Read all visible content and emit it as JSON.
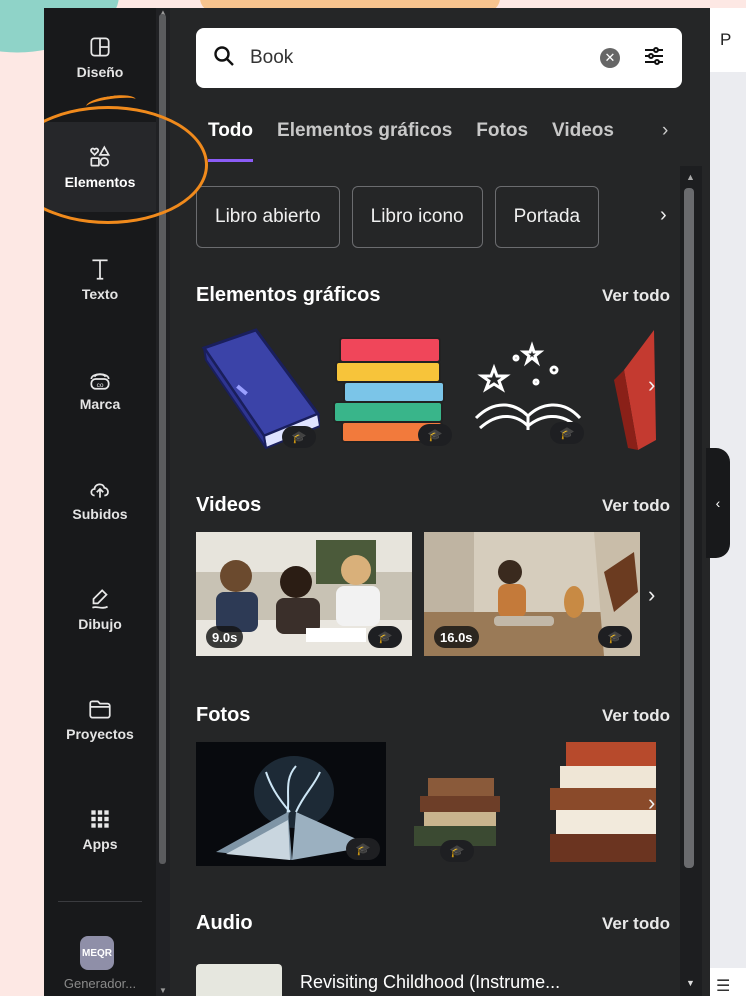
{
  "sidebar": {
    "items": [
      {
        "label": "Diseño",
        "icon": "layout-icon"
      },
      {
        "label": "Elementos",
        "icon": "shapes-icon",
        "active": true
      },
      {
        "label": "Texto",
        "icon": "text-icon"
      },
      {
        "label": "Marca",
        "icon": "brand-icon"
      },
      {
        "label": "Subidos",
        "icon": "cloud-upload-icon"
      },
      {
        "label": "Dibujo",
        "icon": "draw-icon"
      },
      {
        "label": "Proyectos",
        "icon": "folder-icon"
      },
      {
        "label": "Apps",
        "icon": "apps-grid-icon"
      }
    ],
    "extra_app": {
      "icon_text": "MEQR",
      "label": "Generador..."
    }
  },
  "search": {
    "value": "Book"
  },
  "tabs": [
    "Todo",
    "Elementos gráficos",
    "Fotos",
    "Videos"
  ],
  "chips": [
    "Libro abierto",
    "Libro icono",
    "Portada"
  ],
  "sections": {
    "graphics": {
      "title": "Elementos gráficos",
      "see_all": "Ver todo"
    },
    "videos": {
      "title": "Videos",
      "see_all": "Ver todo",
      "durations": [
        "9.0s",
        "16.0s"
      ]
    },
    "photos": {
      "title": "Fotos",
      "see_all": "Ver todo"
    },
    "audio": {
      "title": "Audio",
      "see_all": "Ver todo",
      "track": "Revisiting Childhood (Instrume..."
    }
  },
  "canvas": {
    "top_label": "P"
  },
  "colors": {
    "accent": "#8b5cf6",
    "annotation": "#f08a1c",
    "panel_bg": "#252627"
  }
}
